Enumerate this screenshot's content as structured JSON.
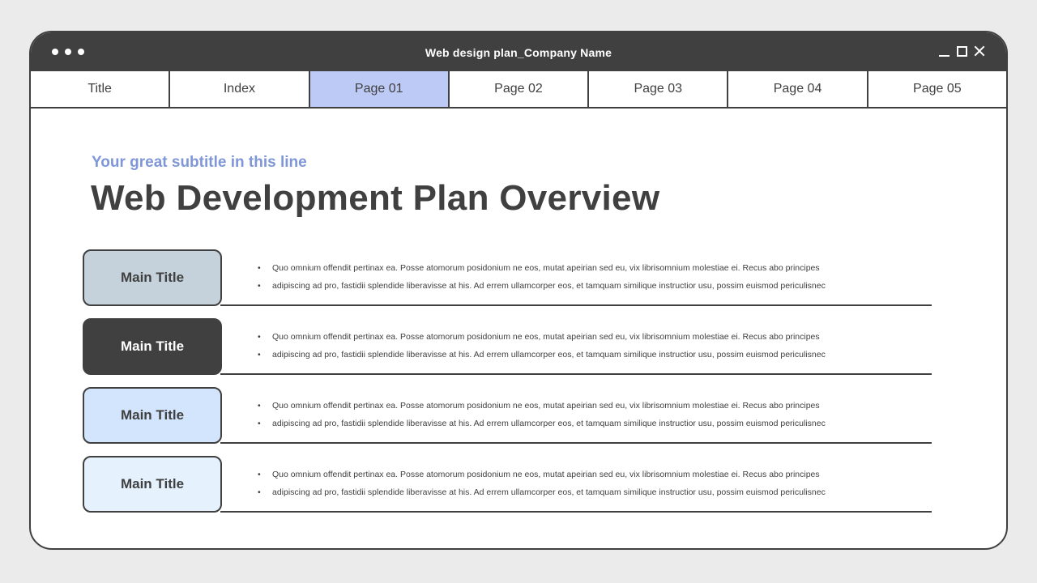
{
  "window": {
    "title": "Web design plan_Company Name"
  },
  "tabs": [
    {
      "label": "Title",
      "active": false
    },
    {
      "label": "Index",
      "active": false
    },
    {
      "label": "Page 01",
      "active": true
    },
    {
      "label": "Page 02",
      "active": false
    },
    {
      "label": "Page 03",
      "active": false
    },
    {
      "label": "Page 04",
      "active": false
    },
    {
      "label": "Page 05",
      "active": false
    }
  ],
  "header": {
    "subtitle": "Your great subtitle in this line",
    "title": "Web Development Plan Overview"
  },
  "rows": [
    {
      "label": "Main Title",
      "color": "#c5d2dc",
      "bullets": [
        "Quo omnium offendit pertinax ea. Posse atomorum posidonium ne eos, mutat apeirian sed eu, vix librisomnium molestiae ei. Recus abo principes",
        "adipiscing ad pro, fastidii splendide liberavisse at his. Ad errem ullamcorper eos, et tamquam similique instructior usu, possim euismod periculisnec"
      ]
    },
    {
      "label": "Main Title",
      "color": "#404040",
      "bullets": [
        "Quo omnium offendit pertinax ea. Posse atomorum posidonium ne eos, mutat apeirian sed eu, vix librisomnium molestiae ei. Recus abo principes",
        "adipiscing ad pro, fastidii splendide liberavisse at his. Ad errem ullamcorper eos, et tamquam similique instructior usu, possim euismod periculisnec"
      ]
    },
    {
      "label": "Main Title",
      "color": "#d3e4fd",
      "bullets": [
        "Quo omnium offendit pertinax ea. Posse atomorum posidonium ne eos, mutat apeirian sed eu, vix librisomnium molestiae ei. Recus abo principes",
        "adipiscing ad pro, fastidii splendide liberavisse at his. Ad errem ullamcorper eos, et tamquam similique instructior usu, possim euismod periculisnec"
      ]
    },
    {
      "label": "Main Title",
      "color": "#e5f2fe",
      "bullets": [
        "Quo omnium offendit pertinax ea. Posse atomorum posidonium ne eos, mutat apeirian sed eu, vix librisomnium molestiae ei. Recus abo principes",
        "adipiscing ad pro, fastidii splendide liberavisse at his. Ad errem ullamcorper eos, et tamquam similique instructior usu, possim euismod periculisnec"
      ]
    }
  ],
  "colors": {
    "frame": "#404040",
    "active_tab": "#bccaf5",
    "subtitle": "#7f96d8",
    "background": "#ebebeb"
  },
  "icons": {
    "menu": "dots-menu-icon",
    "minimize": "minimize-icon",
    "maximize": "maximize-icon",
    "close": "close-icon"
  }
}
